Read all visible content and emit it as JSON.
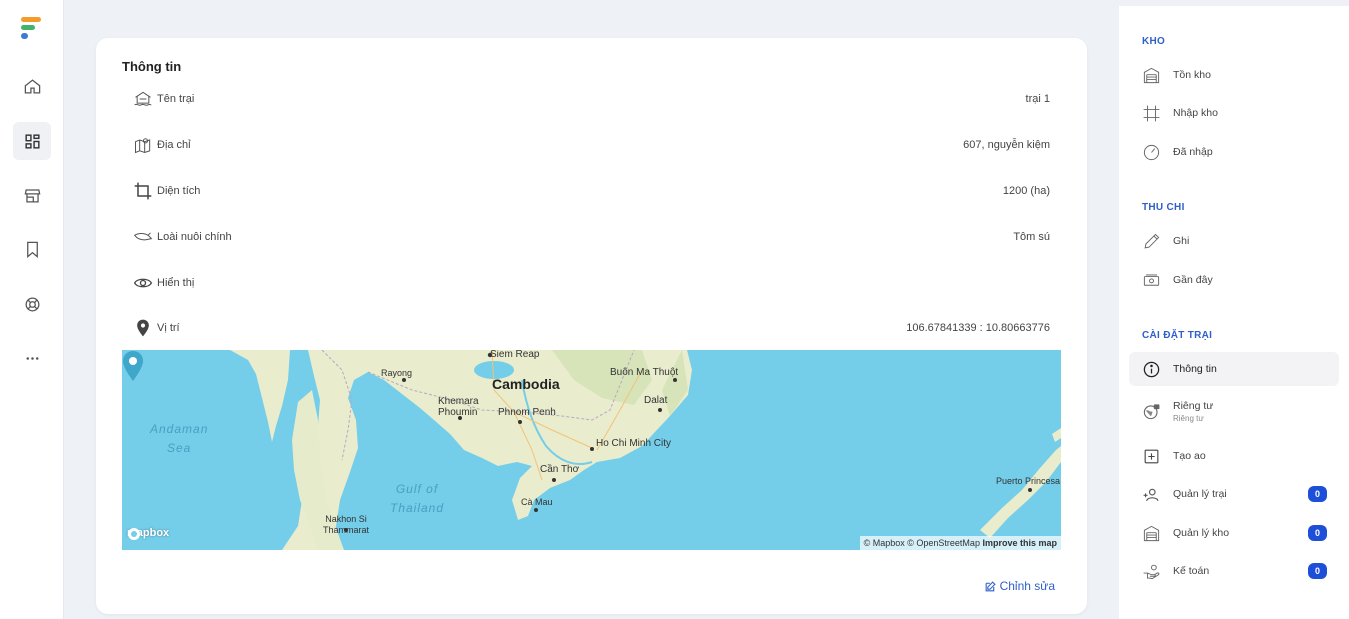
{
  "card": {
    "title": "Thông tin",
    "rows": [
      {
        "label": "Tên trại",
        "value": "trại 1",
        "icon": "farm-icon"
      },
      {
        "label": "Địa chỉ",
        "value": "607, nguyễn kiệm",
        "icon": "map-address-icon"
      },
      {
        "label": "Diện tích",
        "value": "1200 (ha)",
        "icon": "crop-icon"
      },
      {
        "label": "Loài nuôi chính",
        "value": "Tôm sú",
        "icon": "shrimp-icon"
      },
      {
        "label": "Hiển thị",
        "value": "",
        "icon": "eye-icon"
      },
      {
        "label": "Vị trí",
        "value": "106.67841339 : 10.80663776",
        "icon": "location-pin-icon"
      }
    ],
    "edit_label": "Chỉnh sửa"
  },
  "map": {
    "labels": {
      "cambodia": "Cambodia",
      "siem_reap": "Siem Reap",
      "rayong": "Rayong",
      "buon_ma_thuot": "Buôn Ma Thuột",
      "khemara_phoumin": "Khemara\nPhoumin",
      "phnom_penh": "Phnom Penh",
      "dalat": "Dalat",
      "hcmc": "Ho Chi Minh City",
      "can_tho": "Cần Thơ",
      "ca_mau": "Cà Mau",
      "nakhon": "Nakhon Si\nThammarat",
      "puerto": "Puerto Princesa",
      "andaman": "Andaman\nSea",
      "gulf": "Gulf of\nThailand"
    },
    "brand": "mapbox",
    "attribution": "© Mapbox © OpenStreetMap",
    "improve": "Improve this map",
    "colors": {
      "water": "#74cde9",
      "land": "#e9eccd"
    }
  },
  "sidebar": {
    "sections": [
      {
        "title": "KHO",
        "items": [
          {
            "label": "Tồn kho",
            "icon": "warehouse-icon"
          },
          {
            "label": "Nhập kho",
            "icon": "import-frame-icon"
          },
          {
            "label": "Đã nhập",
            "icon": "gauge-icon"
          }
        ]
      },
      {
        "title": "THU CHI",
        "items": [
          {
            "label": "Ghi",
            "icon": "pencil-icon"
          },
          {
            "label": "Gần đây",
            "icon": "cash-icon"
          }
        ]
      },
      {
        "title": "CÀI ĐẶT TRẠI",
        "items": [
          {
            "label": "Thông tin",
            "icon": "info-icon",
            "active": true
          },
          {
            "label": "Riêng tư",
            "sub": "Riêng tư",
            "icon": "globe-lock-icon"
          },
          {
            "label": "Tạo ao",
            "icon": "add-square-icon"
          },
          {
            "label": "Quản lý trại",
            "icon": "users-add-icon",
            "badge": "0"
          },
          {
            "label": "Quản lý kho",
            "icon": "warehouse-icon",
            "badge": "0"
          },
          {
            "label": "Kế toán",
            "icon": "hand-coin-icon",
            "badge": "0"
          }
        ]
      }
    ]
  },
  "colors": {
    "accent": "#2f5fc9",
    "badge": "#1e4fd8",
    "background": "#eef1f6"
  }
}
